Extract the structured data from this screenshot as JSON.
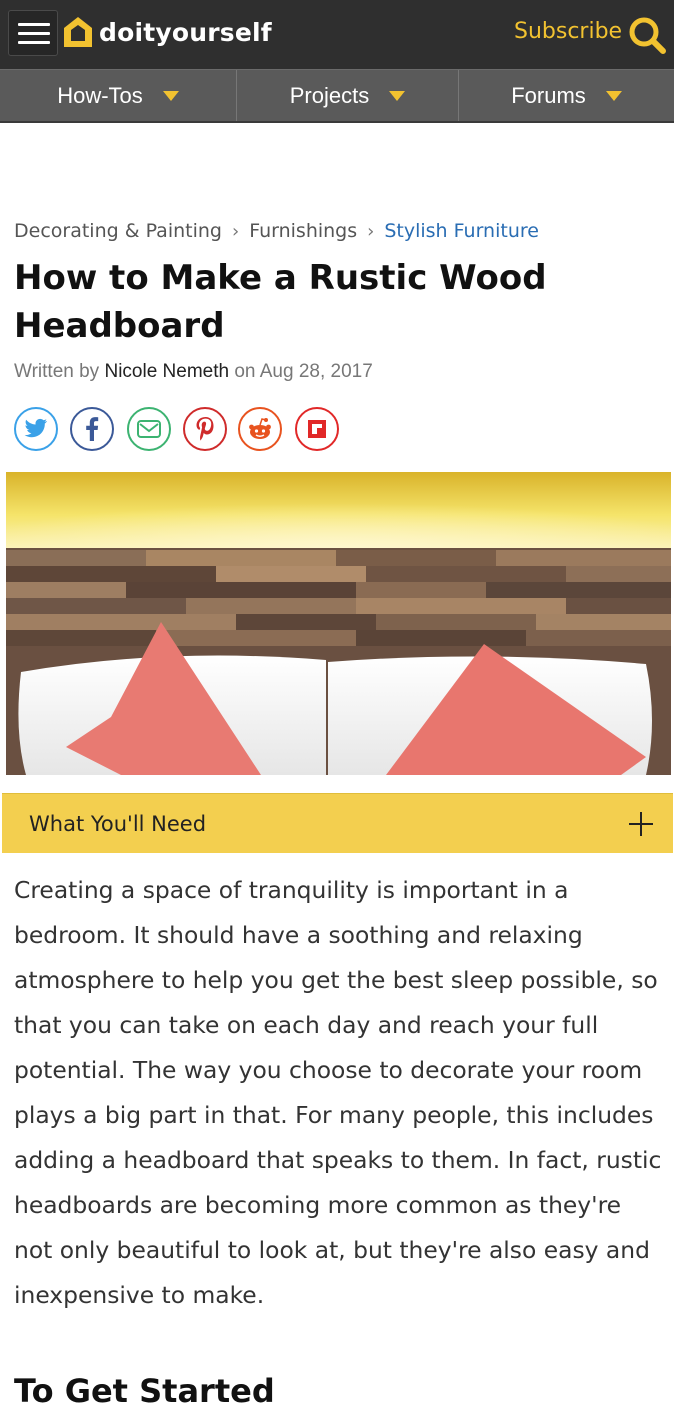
{
  "header": {
    "logo_text": "doityourself",
    "subscribe_label": "Subscribe",
    "brand_color": "#f2c230"
  },
  "nav": {
    "items": [
      {
        "label": "How-Tos"
      },
      {
        "label": "Projects"
      },
      {
        "label": "Forums"
      }
    ]
  },
  "breadcrumb": {
    "items": [
      "Decorating & Painting",
      "Furnishings",
      "Stylish Furniture"
    ]
  },
  "article": {
    "title": "How to Make a Rustic Wood Headboard",
    "byline_prefix": "Written by",
    "author": "Nicole Nemeth",
    "byline_on": "on",
    "date": "Aug 28, 2017",
    "share_icons": [
      "twitter-icon",
      "facebook-icon",
      "email-icon",
      "pinterest-icon",
      "reddit-icon",
      "flipboard-icon"
    ],
    "what_you_need_label": "What You'll Need",
    "intro": "Creating a space of tranquility is important in a bedroom. It should have a soothing and relaxing atmosphere to help you get the best sleep possible, so that you can take on each day and reach your full potential. The way you choose to decorate your room plays a big part in that. For many people, this includes adding a headboard that speaks to them. In fact, rustic headboards are becoming more common as they're not only beautiful to look at, but they're also easy and inexpensive to make.",
    "section_heading": "To Get Started"
  }
}
